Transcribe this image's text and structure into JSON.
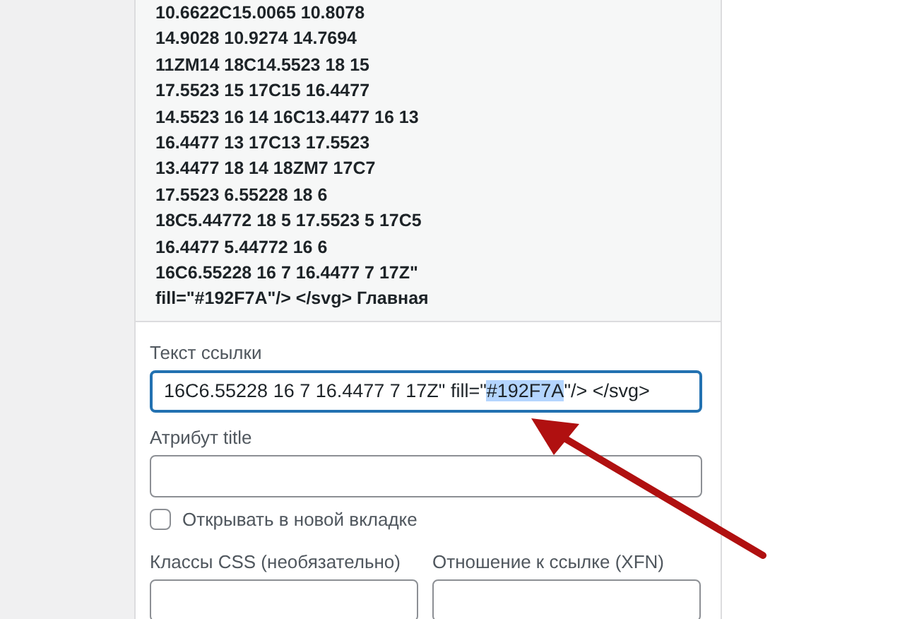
{
  "code_lines": [
    "10.6622C15.0065 10.8078",
    "14.9028 10.9274 14.7694",
    "11ZM14 18C14.5523 18 15",
    "17.5523 15 17C15 16.4477",
    "14.5523 16 14 16C13.4477 16 13",
    "16.4477 13 17C13 17.5523",
    "13.4477 18 14 18ZM7 17C7",
    "17.5523 6.55228 18 6",
    "18C5.44772 18 5 17.5523 5 17C5",
    "16.4477 5.44772 16 6",
    "16C6.55228 16 7 16.4477 7 17Z\"",
    "fill=\"#192F7A\"/> </svg> Главная"
  ],
  "link_text": {
    "label": "Текст ссылки",
    "value_before": "16C6.55228 16 7 16.4477 7 17Z\" fill=\"",
    "value_selected": "#192F7A",
    "value_after": "\"/> </svg>",
    "focused": true
  },
  "title_attribute": {
    "label": "Атрибут title"
  },
  "new_tab": {
    "label": "Открывать в новой вкладке",
    "checked": false
  },
  "css_classes": {
    "label": "Классы CSS (необязательно)"
  },
  "link_rel": {
    "label": "Отношение к ссылке (XFN)"
  }
}
